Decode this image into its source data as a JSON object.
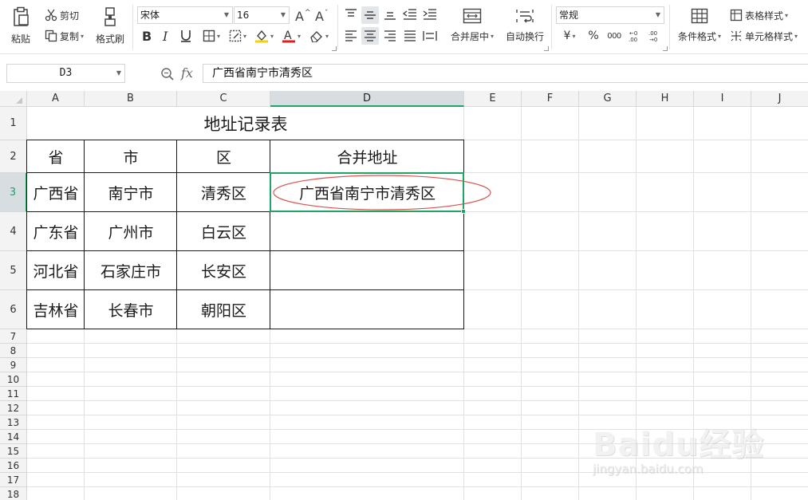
{
  "ribbon": {
    "paste": "粘贴",
    "cut": "剪切",
    "copy": "复制",
    "format_painter": "格式刷",
    "font_name": "宋体",
    "font_size": "16",
    "merge_center": "合并居中",
    "wrap_text": "自动换行",
    "number_format": "常规",
    "currency_symbol": "¥",
    "percent_symbol": "%",
    "thousands_symbol": "000",
    "conditional_format": "条件格式",
    "table_style": "表格样式",
    "cell_style": "单元格样式"
  },
  "formula_bar": {
    "name_box": "D3",
    "fx_label": "fx",
    "content": "广西省南宁市清秀区"
  },
  "sheet": {
    "columns": [
      "A",
      "B",
      "C",
      "D",
      "E",
      "F",
      "G",
      "H",
      "I",
      "J"
    ],
    "rows": [
      "1",
      "2",
      "3",
      "4",
      "5",
      "6",
      "7",
      "8",
      "9",
      "10",
      "11",
      "12",
      "13",
      "14",
      "15",
      "16",
      "17",
      "18"
    ],
    "selected_column": "D",
    "selected_row": "3",
    "title": "地址记录表",
    "headers": [
      "省",
      "市",
      "区",
      "合并地址"
    ],
    "data": [
      [
        "广西省",
        "南宁市",
        "清秀区",
        "广西省南宁市清秀区"
      ],
      [
        "广东省",
        "广州市",
        "白云区",
        ""
      ],
      [
        "河北省",
        "石家庄市",
        "长安区",
        ""
      ],
      [
        "吉林省",
        "长春市",
        "朝阳区",
        ""
      ]
    ],
    "highlight_color": "#d9534f",
    "selection_color": "#21a366"
  },
  "watermark": {
    "logo": "Baidu经验",
    "url": "jingyan.baidu.com"
  }
}
